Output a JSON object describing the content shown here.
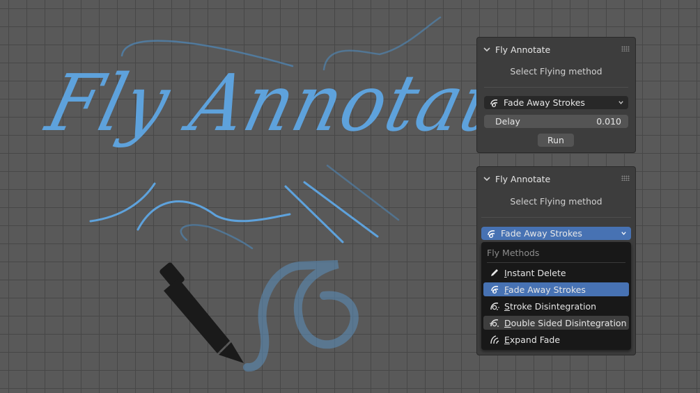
{
  "hero": {
    "title": "Fly Annotate"
  },
  "colors": {
    "stroke": "#5ea2dc",
    "accent": "#4772b3",
    "pencil": "#1a1a1a"
  },
  "panel_top": {
    "header": "Fly Annotate",
    "subtitle": "Select Flying method",
    "method": "Fade Away Strokes",
    "delay_label": "Delay",
    "delay_value": "0.010",
    "run_label": "Run"
  },
  "panel_bottom": {
    "header": "Fly Annotate",
    "subtitle": "Select Flying method",
    "method": "Fade Away Strokes",
    "menu_title": "Fly Methods",
    "items": [
      {
        "label": "Instant Delete",
        "icon": "pencil-icon",
        "state": "normal"
      },
      {
        "label": "Fade Away Strokes",
        "icon": "fade-strokes-icon",
        "state": "selected"
      },
      {
        "label": "Stroke Disintegration",
        "icon": "disintegration-icon",
        "state": "normal"
      },
      {
        "label": "Double Sided Disintegration",
        "icon": "double-disintegration-icon",
        "state": "hover"
      },
      {
        "label": "Expand Fade",
        "icon": "expand-fade-icon",
        "state": "normal"
      }
    ]
  }
}
